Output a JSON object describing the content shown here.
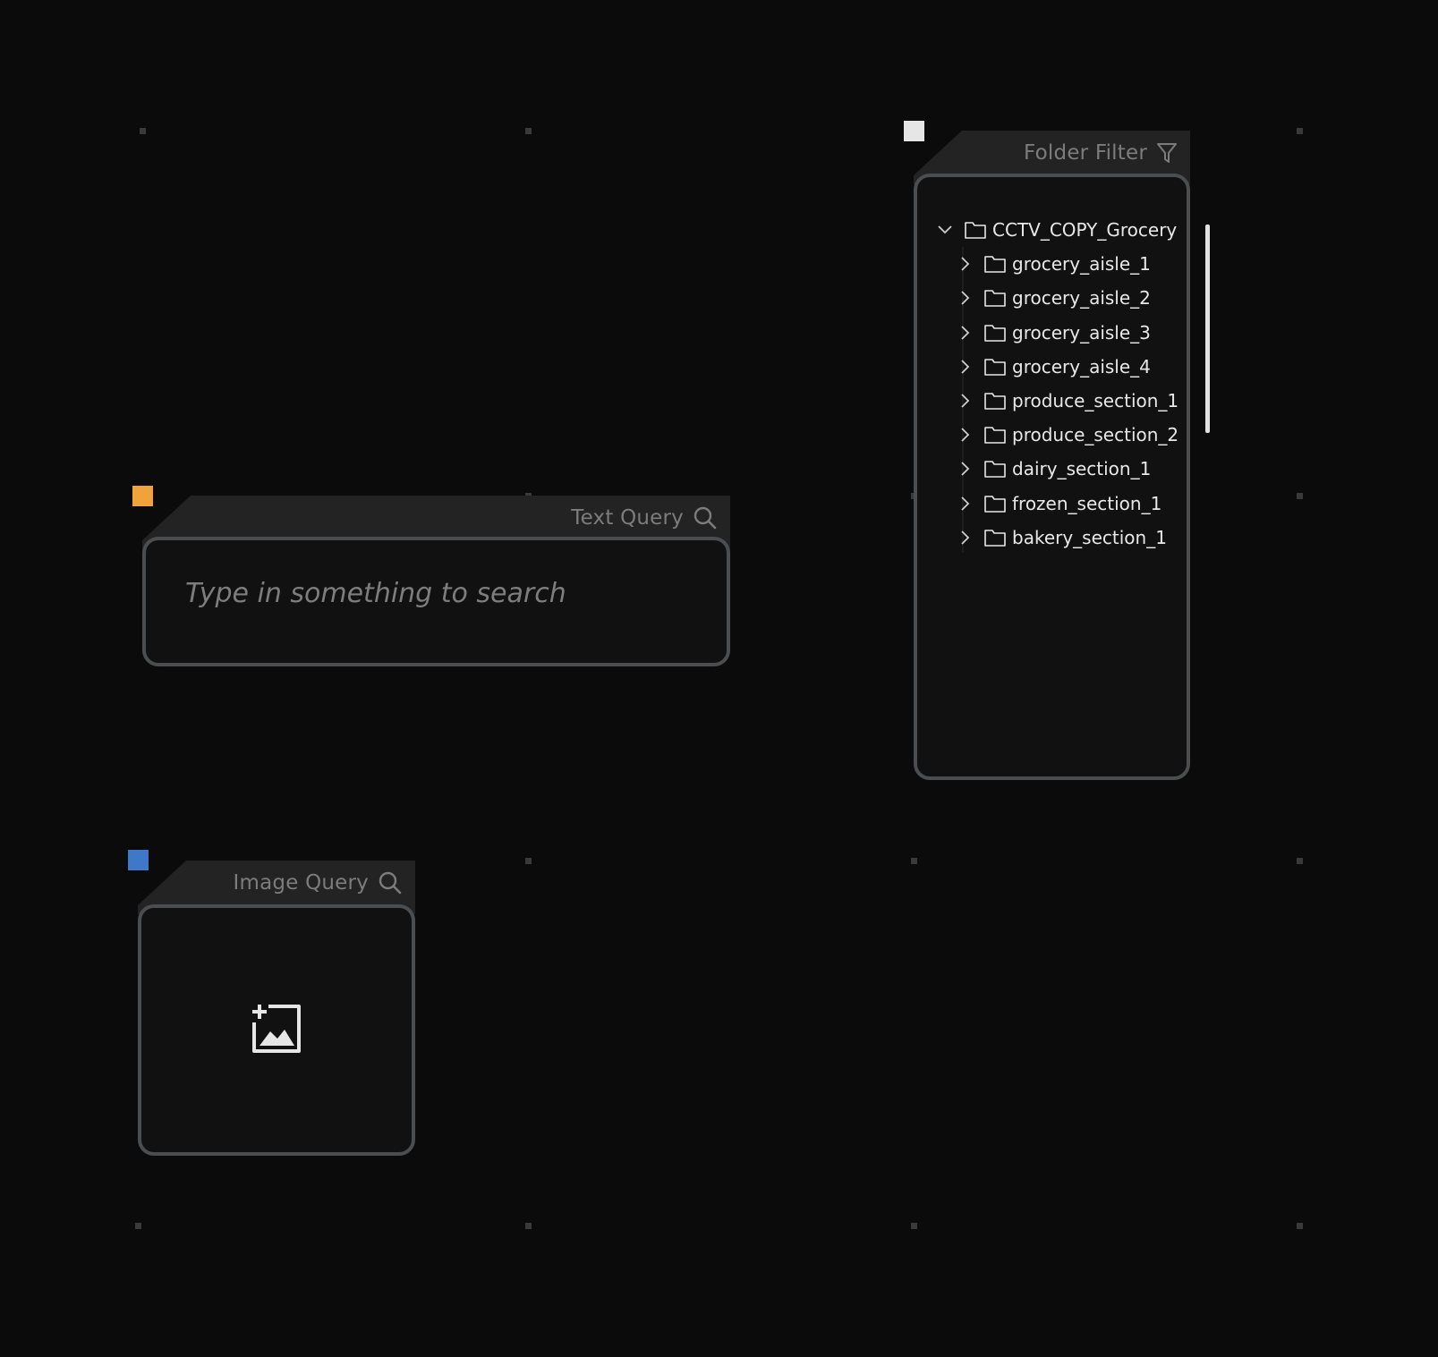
{
  "text_query": {
    "title": "Text Query",
    "title_icon": "search-icon",
    "placeholder": "Type in something to search",
    "value": "",
    "accent_color": "#f0a33a"
  },
  "folder_filter": {
    "title": "Folder Filter",
    "title_icon": "filter-icon",
    "accent_color": "#e6e6e6",
    "root": {
      "label": "CCTV_COPY_Grocery",
      "expanded": true,
      "children": [
        {
          "label": "grocery_aisle_1",
          "expanded": false
        },
        {
          "label": "grocery_aisle_2",
          "expanded": false
        },
        {
          "label": "grocery_aisle_3",
          "expanded": false
        },
        {
          "label": "grocery_aisle_4",
          "expanded": false
        },
        {
          "label": "produce_section_1",
          "expanded": false
        },
        {
          "label": "produce_section_2",
          "expanded": false
        },
        {
          "label": "dairy_section_1",
          "expanded": false
        },
        {
          "label": "frozen_section_1",
          "expanded": false
        },
        {
          "label": "bakery_section_1",
          "expanded": false
        }
      ]
    }
  },
  "image_query": {
    "title": "Image Query",
    "title_icon": "search-icon",
    "upload_icon": "add-image-icon",
    "accent_color": "#3f78c8"
  },
  "colors": {
    "background": "#0b0b0b",
    "panel_header": "#232323",
    "panel_body": "#111111",
    "panel_border": "#4a4e50",
    "muted_text": "#7c7c7c",
    "tree_text": "#e8e8e8"
  }
}
